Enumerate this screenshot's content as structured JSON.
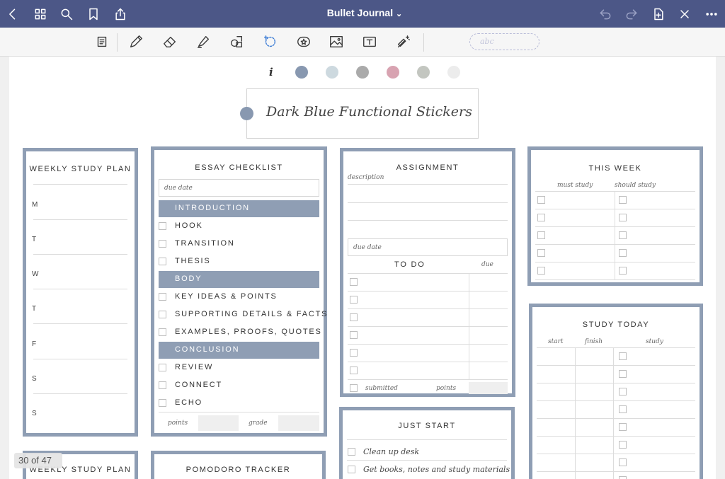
{
  "app": {
    "title": "Bullet Journal",
    "title_chevron": "⌄",
    "page_counter": "30 of 47"
  },
  "titlebar": {
    "left_icons": [
      "back-chevron-icon",
      "grid-thumbnails-icon",
      "search-icon",
      "bookmark-icon",
      "share-icon"
    ],
    "right_icons": [
      "undo-icon",
      "redo-icon",
      "add-page-icon",
      "close-icon",
      "more-icon"
    ]
  },
  "toolbar": {
    "tools": [
      "read-mode-icon",
      "pen-icon",
      "eraser-icon",
      "highlighter-icon",
      "shapes-icon",
      "lasso-icon",
      "sticker-icon",
      "image-icon",
      "text-icon",
      "laser-pointer-icon"
    ],
    "handwriting_placeholder": "abc"
  },
  "colors": {
    "titlebar": "#4c5787",
    "accent": "#8f9eb4",
    "swatches": [
      "#8898b0",
      "#cdd9df",
      "#aaaaaa",
      "#d8a3b1",
      "#c3c6c0",
      "#ececec"
    ]
  },
  "palette": {
    "info_label": "i"
  },
  "sticker_title": "Dark Blue Functional Stickers",
  "weekly_study_plan": {
    "title": "WEEKLY STUDY PLAN",
    "days": [
      "M",
      "T",
      "W",
      "T",
      "F",
      "S",
      "S"
    ]
  },
  "essay_checklist": {
    "title": "ESSAY CHECKLIST",
    "due_date": "due date",
    "sections": [
      {
        "header": "INTRODUCTION",
        "items": [
          "HOOK",
          "TRANSITION",
          "THESIS"
        ]
      },
      {
        "header": "BODY",
        "items": [
          "KEY IDEAS & POINTS",
          "SUPPORTING DETAILS & FACTS",
          "EXAMPLES, PROOFS, QUOTES"
        ]
      },
      {
        "header": "CONCLUSION",
        "items": [
          "REVIEW",
          "CONNECT",
          "ECHO"
        ]
      }
    ],
    "points": "points",
    "grade": "grade"
  },
  "assignment": {
    "title": "ASSIGNMENT",
    "description": "description",
    "due_date": "due date",
    "todo": "TO DO",
    "due": "due",
    "submitted": "submitted",
    "points": "points"
  },
  "this_week": {
    "title": "THIS WEEK",
    "must_study": "must study",
    "should_study": "should study"
  },
  "study_today": {
    "title": "STUDY TODAY",
    "start": "start",
    "finish": "finish",
    "study": "study"
  },
  "just_start": {
    "title": "JUST START",
    "items": [
      "Clean up desk",
      "Get books, notes and study materials"
    ]
  },
  "bottom_cards": {
    "weekly_study_plan_title": "WEEKLY STUDY PLAN",
    "pomodoro_title": "POMODORO TRACKER"
  }
}
